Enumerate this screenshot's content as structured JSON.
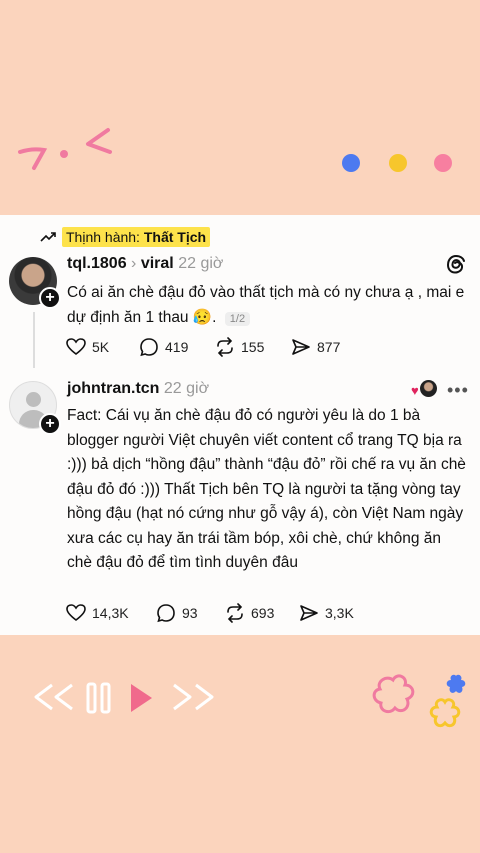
{
  "trending": {
    "prefix": "Thịnh hành:",
    "topic": "Thất Tịch"
  },
  "post1": {
    "username": "tql.1806",
    "community": "viral",
    "time": "22 giờ",
    "text": "Có ai ăn chè đậu đỏ vào thất tịch mà có ny chưa ạ , mai e dự định ăn 1 thau 😥.",
    "pager": "1/2",
    "likes": "5K",
    "comments": "419",
    "reposts": "155",
    "shares": "877"
  },
  "post2": {
    "username": "johntran.tcn",
    "time": "22 giờ",
    "text": "Fact: Cái vụ ăn chè đậu đỏ có người yêu là do 1 bà blogger người Việt chuyên viết content cổ trang TQ bịa ra :))) bả dịch “hồng đậu” thành “đậu đỏ” rồi chế ra vụ ăn chè đậu đỏ đó :))) Thất Tịch bên TQ là người  ta tặng vòng tay hồng đậu (hạt nó cứng như gỗ vậy á), còn Việt Nam ngày xưa các cụ hay ăn trái tầm bóp, xôi chè, chứ không ăn chè đậu đỏ để tìm tình duyên đâu",
    "likes": "14,3K",
    "comments": "93",
    "reposts": "693",
    "shares": "3,3K"
  },
  "colors": {
    "background": "#fbd4bd",
    "dot_blue": "#4d7af0",
    "dot_yellow": "#f7c62c",
    "dot_pink": "#f77fa0",
    "highlight": "#fde24b"
  }
}
